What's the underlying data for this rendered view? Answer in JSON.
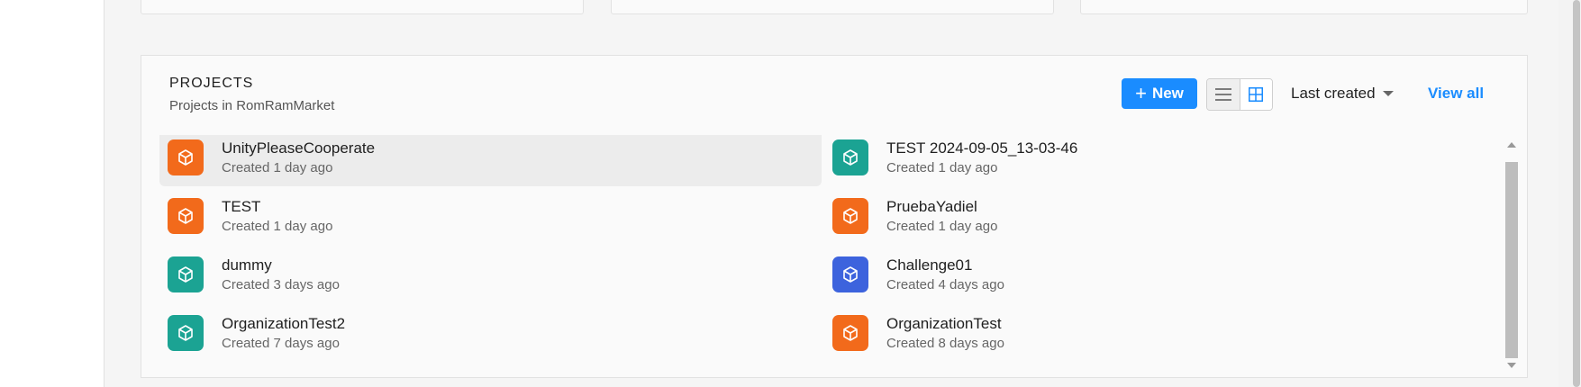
{
  "panel": {
    "title": "PROJECTS",
    "subtitle": "Projects in RomRamMarket"
  },
  "toolbar": {
    "new_label": "New",
    "sort_label": "Last created",
    "view_all_label": "View all",
    "new_icon": "plus-icon",
    "list_view_icon": "list-icon",
    "grid_view_icon": "grid-icon",
    "sort_icon": "chevron-down-icon"
  },
  "colors": {
    "accent": "#1a8cff",
    "orange": "#f26a1b",
    "teal": "#1ba393",
    "blue": "#3d63dd"
  },
  "projects": [
    {
      "name": "UnityPleaseCooperate",
      "created": "Created 1 day ago",
      "color": "#f26a1b",
      "icon": "cube-icon"
    },
    {
      "name": "TEST 2024-09-05_13-03-46",
      "created": "Created 1 day ago",
      "color": "#1ba393",
      "icon": "cube-icon"
    },
    {
      "name": "TEST",
      "created": "Created 1 day ago",
      "color": "#f26a1b",
      "icon": "cube-icon"
    },
    {
      "name": "PruebaYadiel",
      "created": "Created 1 day ago",
      "color": "#f26a1b",
      "icon": "cube-icon"
    },
    {
      "name": "dummy",
      "created": "Created 3 days ago",
      "color": "#1ba393",
      "icon": "cube-icon"
    },
    {
      "name": "Challenge01",
      "created": "Created 4 days ago",
      "color": "#3d63dd",
      "icon": "cube-icon"
    },
    {
      "name": "OrganizationTest2",
      "created": "Created 7 days ago",
      "color": "#1ba393",
      "icon": "cube-icon"
    },
    {
      "name": "OrganizationTest",
      "created": "Created 8 days ago",
      "color": "#f26a1b",
      "icon": "cube-icon"
    }
  ]
}
